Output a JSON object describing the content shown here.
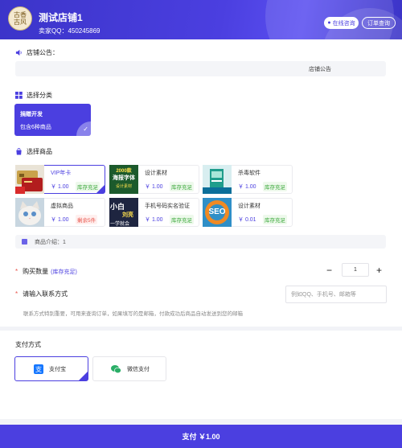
{
  "header": {
    "logo_text": "古香\n古风",
    "shop_name": "测试店铺1",
    "seller_qq": "卖家QQ：450245869",
    "consult_label": "在线咨询",
    "orders_label": "订单查询"
  },
  "notice": {
    "title": "店铺公告：",
    "content": "店铺公告"
  },
  "category": {
    "title": "选择分类",
    "items": [
      {
        "name": "捐赠开发",
        "count": "包含6种商品"
      }
    ]
  },
  "goods": {
    "title": "选择商品",
    "items": [
      {
        "name": "VIP年卡",
        "price": "￥ 1.00",
        "stock": "库存充足",
        "selected": true
      },
      {
        "name": "设计素材",
        "price": "￥ 1.00",
        "stock": "库存充足"
      },
      {
        "name": "杀毒软件",
        "price": "￥ 1.00",
        "stock": "库存充足"
      },
      {
        "name": "虚拟商品",
        "price": "￥ 1.00",
        "stock": "剩余5件"
      },
      {
        "name": "手机号码实名验证",
        "price": "￥ 1.00",
        "stock": "库存充足"
      },
      {
        "name": "设计素材",
        "price": "￥ 0.01",
        "stock": "库存充足"
      }
    ],
    "thumb_text": {
      "font_ad": [
        "2000款",
        "海报字体",
        "设计素材"
      ],
      "seo": "SEO",
      "phone": [
        "小白",
        "刘亮",
        "一学就会"
      ]
    }
  },
  "intro": {
    "text": "商品介绍：1"
  },
  "quantity": {
    "label": "购买数量",
    "hint": "(库存充足)",
    "value": "1",
    "minus": "−",
    "plus": "+"
  },
  "contact": {
    "label": "请输入联系方式",
    "placeholder": "例如QQ、手机号、邮箱等",
    "tip": "联系方式特别重要，可用来查询订单，如果填写的是邮箱，付款成功后商品自动发送到您的邮箱"
  },
  "payment": {
    "title": "支付方式",
    "options": [
      {
        "label": "支付宝",
        "selected": true
      },
      {
        "label": "微信支付"
      }
    ]
  },
  "paybar": {
    "label": "支付 ￥1.00"
  },
  "colors": {
    "accent": "#4b3fe0",
    "stock_ok": "#3aa83a",
    "stock_low": "#e8534a"
  },
  "required_mark": "*"
}
